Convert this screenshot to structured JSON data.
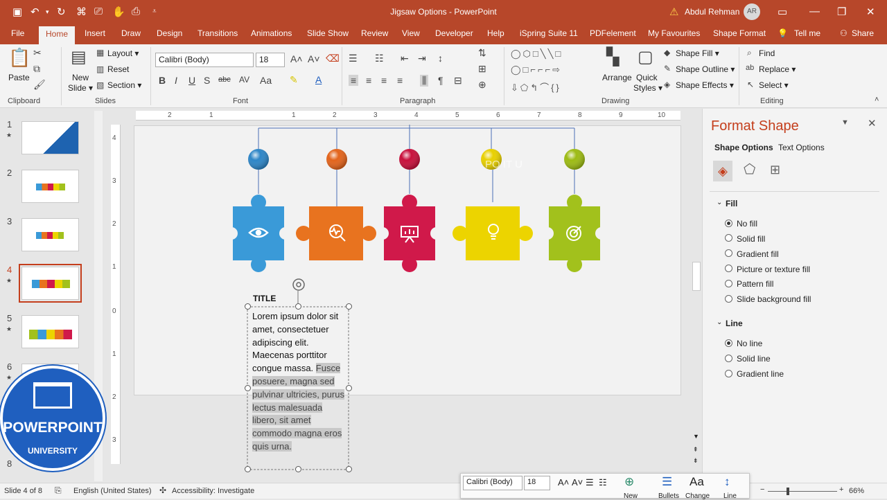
{
  "window": {
    "title": "Jigsaw Options  -  PowerPoint",
    "user": "Abdul Rehman",
    "avatar_initials": "AR"
  },
  "tabs": [
    "File",
    "Home",
    "Insert",
    "Draw",
    "Design",
    "Transitions",
    "Animations",
    "Slide Show",
    "Review",
    "View",
    "Developer",
    "Help",
    "iSpring Suite 11",
    "PDFelement",
    "My Favourites",
    "Shape Format",
    "Tell me",
    "Share"
  ],
  "ribbon": {
    "clipboard": {
      "paste": "Paste",
      "label": "Clipboard"
    },
    "slides": {
      "new_slide": "New",
      "new_slide2": "Slide ▾",
      "layout": "Layout ▾",
      "reset": "Reset",
      "section": "Section ▾",
      "label": "Slides"
    },
    "font": {
      "name": "Calibri (Body)",
      "size": "18",
      "label": "Font"
    },
    "paragraph": {
      "label": "Paragraph"
    },
    "drawing": {
      "arrange": "Arrange",
      "quick_styles": "Quick",
      "quick_styles2": "Styles ▾",
      "shape_fill": "Shape Fill ▾",
      "shape_outline": "Shape Outline ▾",
      "shape_effects": "Shape Effects ▾",
      "label": "Drawing"
    },
    "editing": {
      "find": "Find",
      "replace": "Replace ▾",
      "select": "Select ▾",
      "label": "Editing"
    }
  },
  "slides_panel": {
    "numbers": [
      "1",
      "2",
      "3",
      "4",
      "5",
      "6",
      "8"
    ],
    "selected": "4"
  },
  "rulers": {
    "h": [
      "2",
      "1",
      "1",
      "2",
      "3",
      "4",
      "5",
      "6",
      "7",
      "8",
      "9",
      "10"
    ],
    "v": [
      "4",
      "3",
      "2",
      "1",
      "0",
      "1",
      "2",
      "3"
    ]
  },
  "slide": {
    "ball_colors": [
      "#2e86c7",
      "#e3641c",
      "#c8103c",
      "#e8d000",
      "#9dbb14"
    ],
    "piece_colors": [
      "#3a9ad8",
      "#e8731f",
      "#d0194a",
      "#ecd400",
      "#a2c11c"
    ],
    "icons": [
      "eye-icon",
      "magnifier-pulse-icon",
      "presentation-icon",
      "lightbulb-icon",
      "target-icon"
    ],
    "faint_text": "PO          IT U",
    "title": "TITLE",
    "body_plain": "Lorem ipsum dolor sit amet, consectetuer adipiscing elit. Maecenas porttitor congue massa.",
    "body_selected": "Fusce posuere, magna sed pulvinar ultricies, purus lectus malesuada libero, sit amet commodo magna eros quis urna."
  },
  "format_pane": {
    "title": "Format Shape",
    "tab_shape": "Shape Options",
    "tab_text": "Text Options",
    "fill_header": "Fill",
    "fill_options": [
      "No fill",
      "Solid fill",
      "Gradient fill",
      "Picture or texture fill",
      "Pattern fill",
      "Slide background fill"
    ],
    "fill_selected": "No fill",
    "line_header": "Line",
    "line_options": [
      "No line",
      "Solid line",
      "Gradient line"
    ],
    "line_selected": "No line"
  },
  "mini_toolbar": {
    "font": "Calibri (Body)",
    "size": "18",
    "new": "New",
    "bullets": "Bullets",
    "change": "Change",
    "line": "Line"
  },
  "status": {
    "slide": "Slide 4 of 8",
    "language": "English (United States)",
    "accessibility": "Accessibility: Investigate",
    "zoom": "66%"
  },
  "logo": {
    "top": "POWERPOINT",
    "bottom": "UNIVERSITY"
  }
}
